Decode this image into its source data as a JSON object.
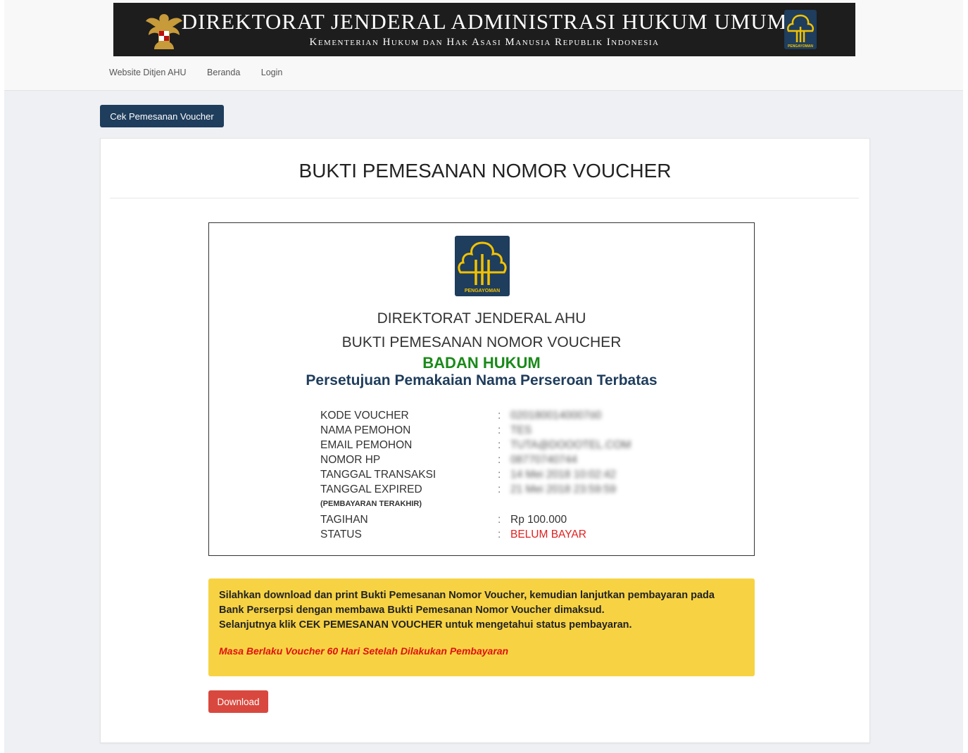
{
  "header": {
    "title": "DIREKTORAT JENDERAL ADMINISTRASI HUKUM UMUM",
    "subtitle": "Kementerian Hukum dan Hak Asasi Manusia Republik Indonesia",
    "logo_text": "PENGAYOMAN"
  },
  "nav": {
    "items": [
      "Website Ditjen AHU",
      "Beranda",
      "Login"
    ]
  },
  "actions": {
    "cek_label": "Cek Pemesanan Voucher",
    "download_label": "Download"
  },
  "page": {
    "title": "BUKTI PEMESANAN NOMOR VOUCHER"
  },
  "receipt": {
    "logo_text": "PENGAYOMAN",
    "line1": "DIREKTORAT JENDERAL AHU",
    "line2": "BUKTI PEMESANAN NOMOR VOUCHER",
    "line3": "BADAN HUKUM",
    "line4": "Persetujuan Pemakaian Nama Perseroan Terbatas",
    "colon": ":",
    "rows": [
      {
        "label": "KODE VOUCHER",
        "value": "0201800140007ö0"
      },
      {
        "label": "NAMA PEMOHON",
        "value": "TES"
      },
      {
        "label": "EMAIL PEMOHON",
        "value": "TUTA@DOOOTEL.COM"
      },
      {
        "label": "NOMOR HP",
        "value": "08770740744"
      },
      {
        "label": "TANGGAL TRANSAKSI",
        "value": "14 Mei 2018 10:02:42"
      },
      {
        "label": "TANGGAL EXPIRED",
        "value": "21 Mei 2018 23:59:59"
      },
      {
        "label": "(PEMBAYARAN TERAKHIR)"
      },
      {
        "label": "TAGIHAN",
        "value": "Rp 100.000"
      },
      {
        "label": "STATUS",
        "value": "BELUM BAYAR"
      }
    ]
  },
  "notice": {
    "line1": "Silahkan download dan print Bukti Pemesanan Nomor Voucher, kemudian lanjutkan pembayaran pada",
    "line2": "Bank Perserpsi dengan membawa Bukti Pemesanan Nomor Voucher dimaksud.",
    "line3": "Selanjutnya klik CEK PEMESANAN VOUCHER untuk mengetahui status pembayaran.",
    "validity": "Masa Berlaku Voucher 60 Hari Setelah Dilakukan Pembayaran"
  },
  "colors": {
    "navy": "#1f3d5c",
    "green": "#1a8a1a",
    "red": "#e02020",
    "notice_yellow": "#f7d343",
    "download_red": "#d9483e"
  }
}
